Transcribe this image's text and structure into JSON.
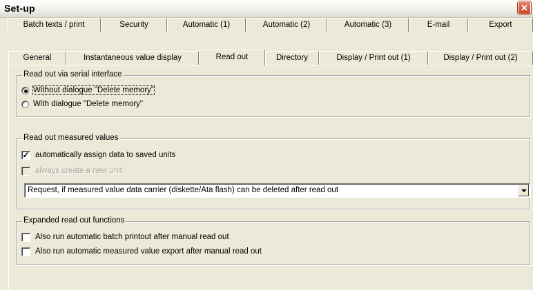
{
  "window": {
    "title": "Set-up",
    "close_glyph": "✕"
  },
  "tabs": {
    "row1": [
      {
        "label": "Batch texts / print"
      },
      {
        "label": "Security"
      },
      {
        "label": "Automatic (1)"
      },
      {
        "label": "Automatic (2)"
      },
      {
        "label": "Automatic (3)"
      },
      {
        "label": "E-mail"
      },
      {
        "label": "Export"
      }
    ],
    "row2": [
      {
        "label": "General"
      },
      {
        "label": "Instantaneous value display"
      },
      {
        "label": "Read out",
        "active": true
      },
      {
        "label": "Directory"
      },
      {
        "label": "Display / Print out (1)"
      },
      {
        "label": "Display / Print out (2)"
      }
    ]
  },
  "serial": {
    "legend": "Read out via serial interface",
    "opt_without": "Without dialogue \"Delete memory\"",
    "opt_with": "With dialogue \"Delete memory\"",
    "selected": "without"
  },
  "measured": {
    "legend": "Read out measured values",
    "auto_assign": {
      "label": "automatically assign data to saved units",
      "checked": true
    },
    "always_new": {
      "label": "always create a new unit",
      "checked": false,
      "disabled": true
    },
    "dropdown_value": "Request, if measured value data carrier (diskette/Ata flash) can be deleted after read out"
  },
  "expanded": {
    "legend": "Expanded read out functions",
    "batch_printout": {
      "label": "Also run automatic batch printout after manual read out",
      "checked": false
    },
    "value_export": {
      "label": "Also run automatic measured value export after manual read out",
      "checked": false
    }
  },
  "colors": {
    "background": "#ece9d8",
    "close_button": "#c44522"
  }
}
